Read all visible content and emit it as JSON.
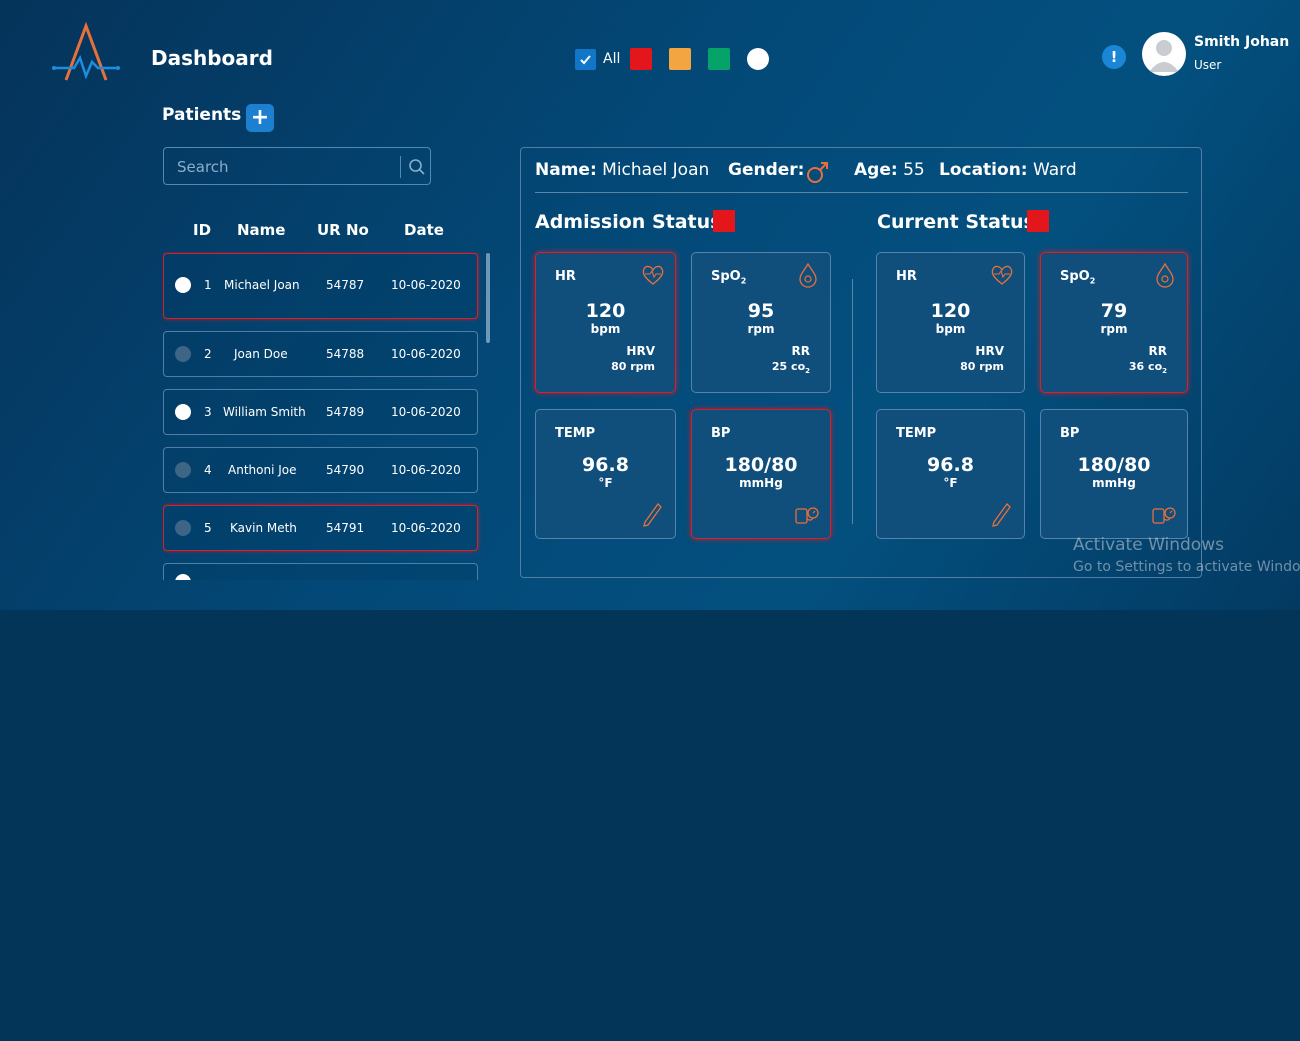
{
  "header": {
    "title": "Dashboard",
    "filters": {
      "all_label": "All",
      "colors": [
        "#e3161c",
        "#f2a540",
        "#05a36a",
        "#ffffff"
      ]
    },
    "user": {
      "name": "Smith Johan",
      "role": "User"
    },
    "alert_icon": "!"
  },
  "patients": {
    "heading": "Patients",
    "add_label": "+",
    "search_placeholder": "Search",
    "columns": [
      "ID",
      "Name",
      "UR No",
      "Date"
    ],
    "rows": [
      {
        "id": "1",
        "name": "Michael Joan",
        "ur": "54787",
        "date": "10-06-2020",
        "status": "alert",
        "dot": "white"
      },
      {
        "id": "2",
        "name": "Joan Doe",
        "ur": "54788",
        "date": "10-06-2020",
        "status": "normal",
        "dot": "grey"
      },
      {
        "id": "3",
        "name": "William Smith",
        "ur": "54789",
        "date": "10-06-2020",
        "status": "normal",
        "dot": "white"
      },
      {
        "id": "4",
        "name": "Anthoni Joe",
        "ur": "54790",
        "date": "10-06-2020",
        "status": "normal",
        "dot": "grey"
      },
      {
        "id": "5",
        "name": "Kavin Meth",
        "ur": "54791",
        "date": "10-06-2020",
        "status": "alert",
        "dot": "grey"
      }
    ]
  },
  "detail": {
    "name_label": "Name:",
    "name": "Michael Joan",
    "gender_label": "Gender:",
    "gender_icon": "male-icon",
    "age_label": "Age:",
    "age": "55",
    "location_label": "Location:",
    "location": "Ward",
    "admission": {
      "title": "Admission Status",
      "hr": {
        "label": "HR",
        "value": "120",
        "unit": "bpm",
        "sub_label": "HRV",
        "sub_value": "80 rpm"
      },
      "spo2": {
        "label": "SpO",
        "label_sub": "2",
        "value": "95",
        "unit": "rpm",
        "sub_label": "RR",
        "sub_value": "25 co",
        "sub_value_sub": "2"
      },
      "temp": {
        "label": "TEMP",
        "value": "96.8",
        "unit": "°F"
      },
      "bp": {
        "label": "BP",
        "value": "180/80",
        "unit": "mmHg"
      }
    },
    "current": {
      "title": "Current Status",
      "hr": {
        "label": "HR",
        "value": "120",
        "unit": "bpm",
        "sub_label": "HRV",
        "sub_value": "80 rpm"
      },
      "spo2": {
        "label": "SpO",
        "label_sub": "2",
        "value": "79",
        "unit": "rpm",
        "sub_label": "RR",
        "sub_value": "36 co",
        "sub_value_sub": "2"
      },
      "temp": {
        "label": "TEMP",
        "value": "96.8",
        "unit": "°F"
      },
      "bp": {
        "label": "BP",
        "value": "180/80",
        "unit": "mmHg"
      }
    }
  },
  "watermark": {
    "line1": "Activate Windows",
    "line2": "Go to Settings to activate Windows."
  }
}
